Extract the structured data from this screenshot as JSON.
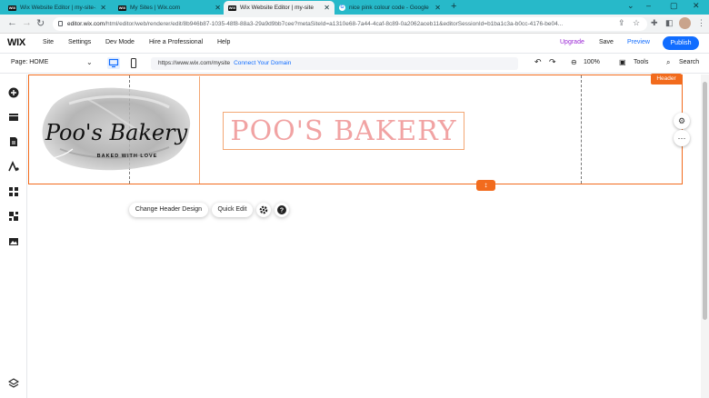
{
  "browser": {
    "tabs": [
      {
        "title": "Wix Website Editor | my-site-1",
        "favicon": "WIX",
        "active": false
      },
      {
        "title": "My Sites | Wix.com",
        "favicon": "WIX",
        "active": false
      },
      {
        "title": "Wix Website Editor | my-site",
        "favicon": "WIX",
        "active": true
      },
      {
        "title": "nice pink colour code - Google S",
        "favicon": "G",
        "active": false
      }
    ],
    "new_tab": "+",
    "url_domain": "editor.wix.com",
    "url_path": "/html/editor/web/renderer/edit/8b946b87-1035-48f8-88a3-29a9d9bb7cee?metaSiteId=a1310e68-7a44-4caf-8c89-0a2062aceb11&editorSessionId=b1ba1c3a-b0cc-4176-be04...",
    "window_controls": [
      "⌄",
      "–",
      "▢",
      "✕"
    ]
  },
  "wix_top": {
    "logo": "WIX",
    "menu": [
      "Site",
      "Settings",
      "Dev Mode",
      "Hire a Professional",
      "Help"
    ],
    "upgrade": "Upgrade",
    "save": "Save",
    "preview": "Preview",
    "publish": "Publish"
  },
  "toolbar2": {
    "page_label": "Page: HOME",
    "site_url": "https://www.wix.com/mysite",
    "connect_domain": "Connect Your Domain",
    "zoom": "100%",
    "tools": "Tools",
    "search": "Search"
  },
  "canvas": {
    "header_tag": "Header",
    "logo_text": "Poo's Bakery",
    "logo_tagline": "BAKED WITH LOVE",
    "site_title": "POO'S BAKERY",
    "change_header_design": "Change Header Design",
    "quick_edit": "Quick Edit",
    "title_color": "#f1a3a3",
    "accent_color": "#f26b1d"
  },
  "left_rail_icons": [
    "add-icon",
    "sections-icon",
    "pages-icon",
    "design-icon",
    "apps-icon",
    "business-icon",
    "media-icon",
    "layers-icon"
  ]
}
